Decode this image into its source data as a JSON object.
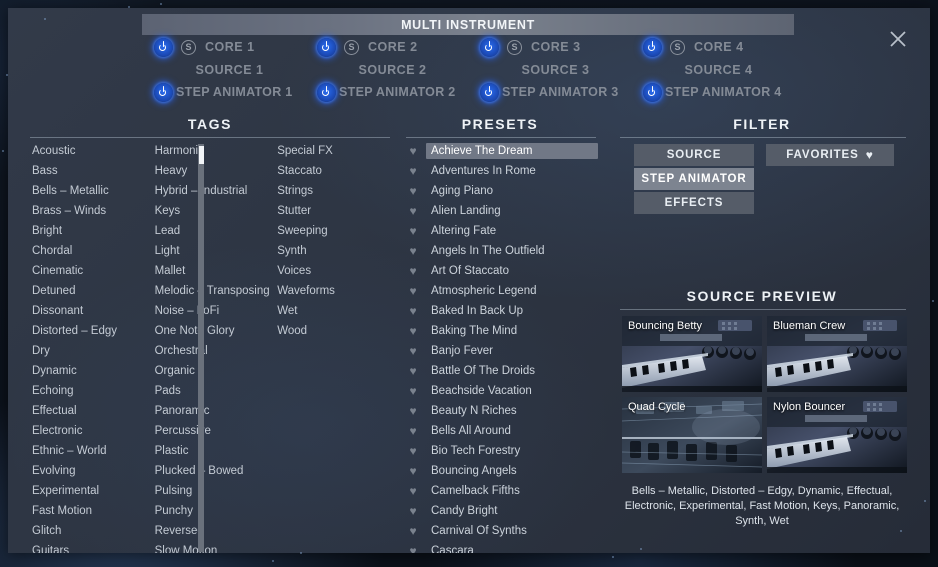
{
  "header": {
    "multi_instrument_title": "MULTI INSTRUMENT",
    "close_icon": "close-icon",
    "cores": [
      {
        "power_icon": "power-icon",
        "solo_label": "S",
        "core_label": "CORE 1",
        "source_label": "SOURCE 1",
        "animator_label": "STEP ANIMATOR 1"
      },
      {
        "power_icon": "power-icon",
        "solo_label": "S",
        "core_label": "CORE 2",
        "source_label": "SOURCE 2",
        "animator_label": "STEP ANIMATOR 2"
      },
      {
        "power_icon": "power-icon",
        "solo_label": "S",
        "core_label": "CORE 3",
        "source_label": "SOURCE 3",
        "animator_label": "STEP ANIMATOR 3"
      },
      {
        "power_icon": "power-icon",
        "solo_label": "S",
        "core_label": "CORE 4",
        "source_label": "SOURCE 4",
        "animator_label": "STEP ANIMATOR 4"
      }
    ]
  },
  "tags": {
    "title": "TAGS",
    "columns": [
      [
        "Acoustic",
        "Bass",
        "Bells – Metallic",
        "Brass – Winds",
        "Bright",
        "Chordal",
        "Cinematic",
        "Detuned",
        "Dissonant",
        "Distorted – Edgy",
        "Dry",
        "Dynamic",
        "Echoing",
        "Effectual",
        "Electronic",
        "Ethnic – World",
        "Evolving",
        "Experimental",
        "Fast Motion",
        "Glitch",
        "Guitars"
      ],
      [
        "Harmonic",
        "Heavy",
        "Hybrid – Industrial",
        "Keys",
        "Lead",
        "Light",
        "Mallet",
        "Melodic – Transposing",
        "Noise – LoFi",
        "One Note Glory",
        "Orchestral",
        "Organic",
        "Pads",
        "Panoramic",
        "Percussive",
        "Plastic",
        "Plucked – Bowed",
        "Pulsing",
        "Punchy",
        "Reversed",
        "Slow Motion"
      ],
      [
        "Special FX",
        "Staccato",
        "Strings",
        "Stutter",
        "Sweeping",
        "Synth",
        "Voices",
        "Waveforms",
        "Wet",
        "Wood"
      ]
    ]
  },
  "presets": {
    "title": "PRESETS",
    "favorite_icon": "heart-icon",
    "selected": "Achieve The Dream",
    "items": [
      "Achieve The Dream",
      "Adventures In Rome",
      "Aging Piano",
      "Alien Landing",
      "Altering Fate",
      "Angels In The Outfield",
      "Art Of Staccato",
      "Atmospheric Legend",
      "Baked In Back Up",
      "Baking The Mind",
      "Banjo Fever",
      "Battle Of The Droids",
      "Beachside Vacation",
      "Beauty N Riches",
      "Bells All Around",
      "Bio Tech Forestry",
      "Bouncing Angels",
      "Camelback Fifths",
      "Candy Bright",
      "Carnival Of Synths",
      "Cascara"
    ]
  },
  "filter": {
    "title": "FILTER",
    "buttons": [
      {
        "label": "SOURCE",
        "active": false
      },
      {
        "label": "STEP ANIMATOR",
        "active": true
      },
      {
        "label": "EFFECTS",
        "active": false
      }
    ],
    "favorites_label": "FAVORITES",
    "favorites_icon": "heart-icon"
  },
  "source_preview": {
    "title": "SOURCE PREVIEW",
    "thumbnails": [
      {
        "label": "Bouncing Betty",
        "image": "synth-keyboard-photo"
      },
      {
        "label": "Blueman Crew",
        "image": "synth-keyboard-photo"
      },
      {
        "label": "Quad Cycle",
        "image": "circuit-board-photo"
      },
      {
        "label": "Nylon Bouncer",
        "image": "synth-keyboard-photo"
      }
    ],
    "tag_summary": "Bells – Metallic, Distorted – Edgy, Dynamic, Effectual, Electronic, Experimental, Fast Motion, Keys, Panoramic, Synth, Wet"
  },
  "colors": {
    "panel_bg": "#2e3644",
    "power_blue": "#2a6cf0",
    "highlight": "#717886",
    "filter_btn": "#555c68",
    "filter_btn_active": "#7d8490",
    "title_bar": "#6c7382",
    "text_primary": "#eef2f6",
    "text_secondary": "#c4cbd4",
    "text_dim": "#848b96"
  }
}
